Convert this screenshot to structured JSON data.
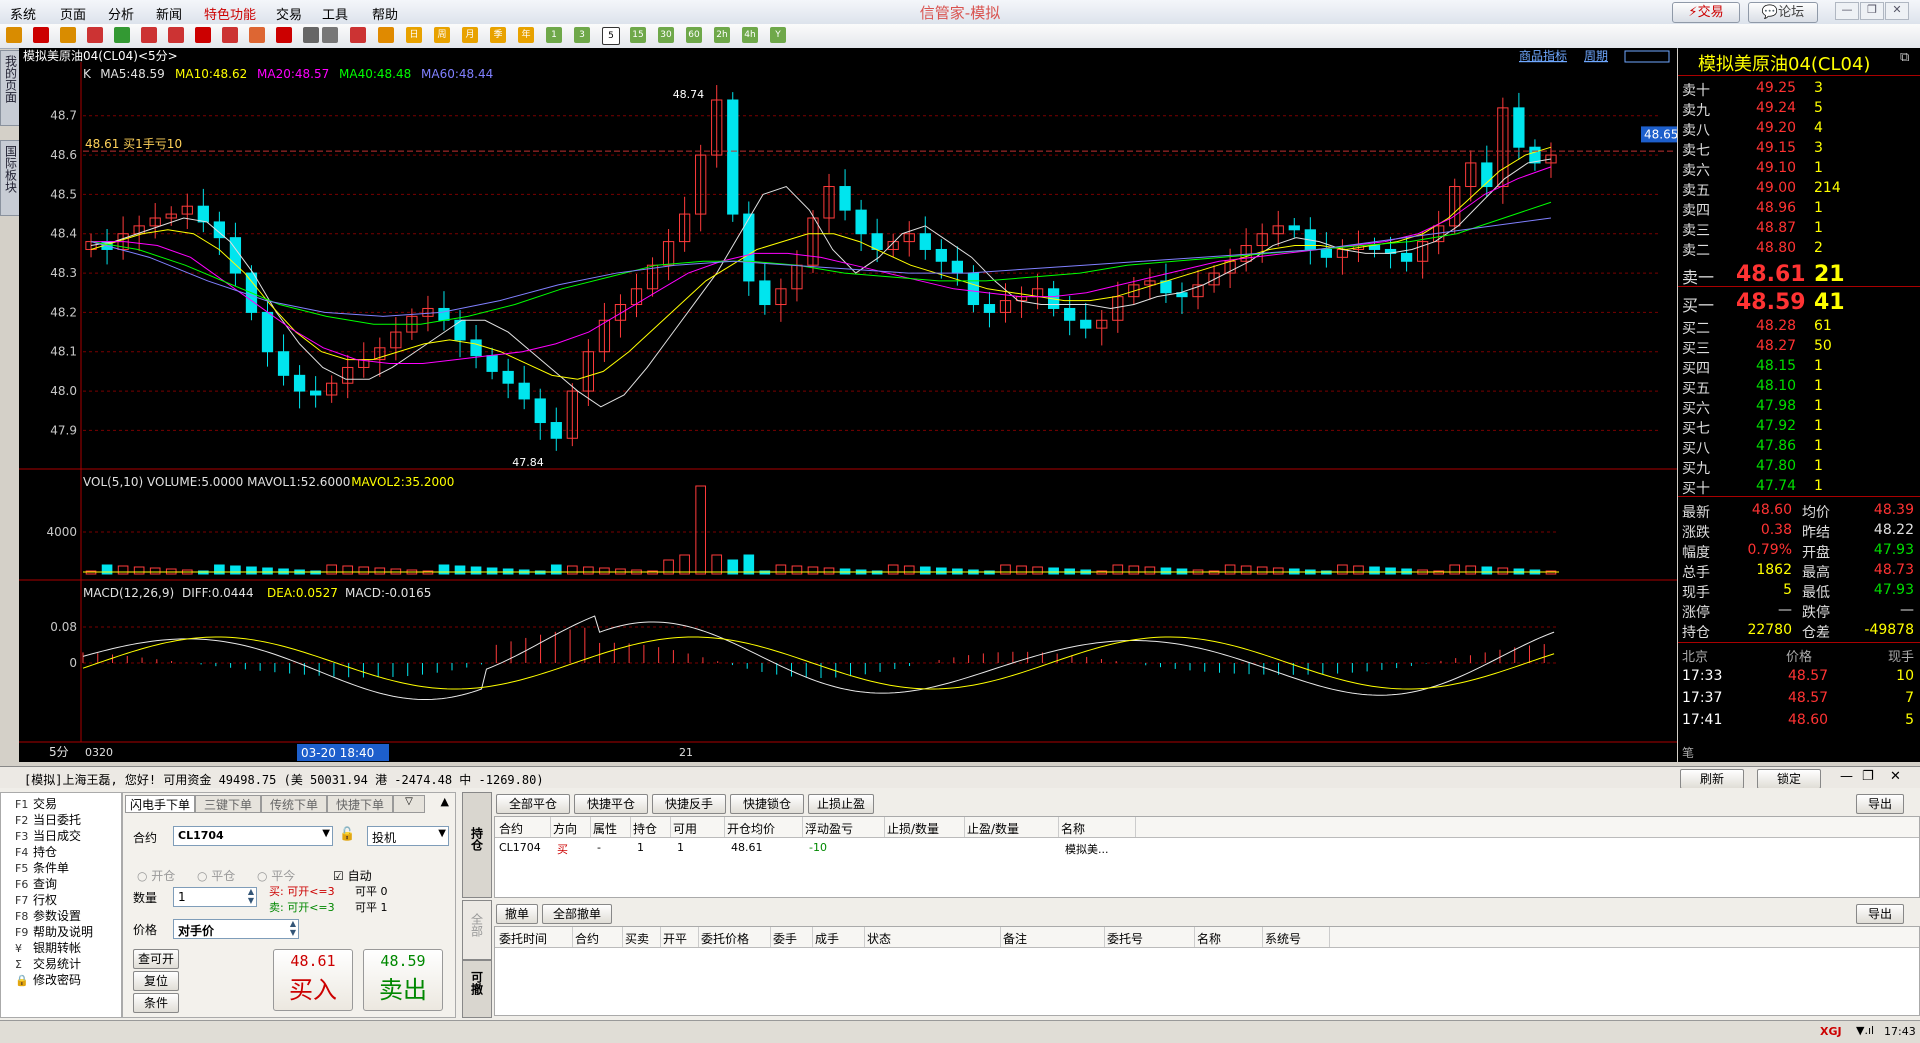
{
  "menu": [
    "系统",
    "页面",
    "分析",
    "新闻",
    "特色功能",
    "交易",
    "工具",
    "帮助"
  ],
  "app_title": "信管家-模拟",
  "top_buttons": {
    "trade": "交易",
    "forum": "论坛"
  },
  "toolbar_periods": [
    "日",
    "周",
    "月",
    "季",
    "年",
    "1",
    "3",
    "5",
    "15",
    "30",
    "60",
    "2h",
    "4h",
    "Y"
  ],
  "left_tabs": {
    "my_page": "我的页面",
    "intl_board": "国际板块"
  },
  "chart": {
    "instrument": "模拟美原油04(CL04)<5分>",
    "links": {
      "product": "商品指标",
      "period": "周期"
    },
    "ma_legend": [
      {
        "text": "K",
        "color": "#e0e0e0"
      },
      {
        "text": "MA5:48.59",
        "color": "#e0e0e0"
      },
      {
        "text": "MA10:48.62",
        "color": "#ffff00"
      },
      {
        "text": "MA20:48.57",
        "color": "#ff00ff"
      },
      {
        "text": "MA40:48.48",
        "color": "#00ff00"
      },
      {
        "text": "MA60:48.44",
        "color": "#8080ff"
      }
    ],
    "position_line_label": "48.61 买1手亏10",
    "price_ticks": [
      "48.7",
      "48.6",
      "48.5",
      "48.4",
      "48.3",
      "48.2",
      "48.1",
      "48.0",
      "47.9"
    ],
    "high_label": "48.74",
    "low_label": "47.84",
    "current_price_tag": "48.65",
    "vol_legend": [
      {
        "text": "VOL(5,10) VOLUME:5.0000 MAVOL1:52.6000",
        "color": "#e0e0e0"
      },
      {
        "text": "MAVOL2:35.2000",
        "color": "#ffff00"
      }
    ],
    "vol_tick": "4000",
    "macd_legend": [
      {
        "text": "MACD(12,26,9)",
        "color": "#e0e0e0"
      },
      {
        "text": "DIFF:0.0444",
        "color": "#e0e0e0"
      },
      {
        "text": "DEA:0.0527",
        "color": "#ffff00"
      },
      {
        "text": "MACD:-0.0165",
        "color": "#e0e0e0"
      }
    ],
    "macd_ticks": [
      "0.08",
      "0"
    ],
    "x_period": "5分",
    "x_labels": [
      "0320",
      "21"
    ],
    "cursor_time": "03-20 18:40"
  },
  "chart_data": {
    "type": "candlestick",
    "price_range": [
      47.84,
      48.74
    ],
    "close": [
      48.38,
      48.36,
      48.4,
      48.42,
      48.44,
      48.45,
      48.47,
      48.43,
      48.39,
      48.3,
      48.2,
      48.1,
      48.04,
      48.0,
      47.99,
      48.02,
      48.06,
      48.08,
      48.11,
      48.15,
      48.19,
      48.21,
      48.18,
      48.13,
      48.09,
      48.05,
      48.02,
      47.98,
      47.92,
      47.88,
      48.0,
      48.1,
      48.18,
      48.22,
      48.26,
      48.32,
      48.38,
      48.45,
      48.6,
      48.74,
      48.45,
      48.28,
      48.22,
      48.26,
      48.32,
      48.44,
      48.52,
      48.46,
      48.4,
      48.36,
      48.38,
      48.4,
      48.36,
      48.33,
      48.3,
      48.22,
      48.2,
      48.23,
      48.24,
      48.26,
      48.21,
      48.18,
      48.16,
      48.18,
      48.24,
      48.27,
      48.28,
      48.25,
      48.24,
      48.27,
      48.3,
      48.33,
      48.37,
      48.4,
      48.42,
      48.41,
      48.36,
      48.34,
      48.36,
      48.37,
      48.36,
      48.35,
      48.33,
      48.38,
      48.42,
      48.52,
      48.58,
      48.52,
      48.72,
      48.62,
      48.58,
      48.6
    ],
    "series": [
      {
        "name": "MA5",
        "values": [
          48.37,
          48.38,
          48.4,
          48.42,
          48.44,
          48.43,
          48.38,
          48.3,
          48.2,
          48.12,
          48.06,
          48.03,
          48.03,
          48.06,
          48.1,
          48.14,
          48.18,
          48.18,
          48.15,
          48.1,
          48.05,
          48.0,
          47.96,
          47.99,
          48.06,
          48.14,
          48.22,
          48.3,
          48.4,
          48.5,
          48.52,
          48.46,
          48.36,
          48.3,
          48.34,
          48.4,
          48.42,
          48.38,
          48.34,
          48.28,
          48.23,
          48.22,
          48.22,
          48.22,
          48.21,
          48.22,
          48.24,
          48.25,
          48.27,
          48.3,
          48.33,
          48.37,
          48.39,
          48.38,
          48.36,
          48.35,
          48.35,
          48.36,
          48.38,
          48.42,
          48.48,
          48.54,
          48.58,
          48.59
        ]
      },
      {
        "name": "MA10",
        "values": [
          48.36,
          48.38,
          48.4,
          48.41,
          48.4,
          48.36,
          48.3,
          48.22,
          48.15,
          48.1,
          48.08,
          48.08,
          48.1,
          48.12,
          48.13,
          48.12,
          48.1,
          48.07,
          48.04,
          48.03,
          48.05,
          48.1,
          48.16,
          48.22,
          48.28,
          48.32,
          48.36,
          48.38,
          48.4,
          48.4,
          48.38,
          48.35,
          48.32,
          48.3,
          48.28,
          48.26,
          48.25,
          48.24,
          48.23,
          48.23,
          48.24,
          48.26,
          48.28,
          48.3,
          48.32,
          48.34,
          48.36,
          48.37,
          48.37,
          48.36,
          48.37,
          48.38,
          48.4,
          48.44,
          48.5,
          48.56,
          48.6,
          48.62
        ]
      },
      {
        "name": "MA20",
        "values": [
          48.38,
          48.38,
          48.37,
          48.34,
          48.28,
          48.22,
          48.16,
          48.11,
          48.08,
          48.07,
          48.07,
          48.08,
          48.09,
          48.1,
          48.12,
          48.15,
          48.2,
          48.25,
          48.3,
          48.33,
          48.35,
          48.35,
          48.34,
          48.32,
          48.3,
          48.28,
          48.26,
          48.25,
          48.24,
          48.24,
          48.25,
          48.27,
          48.29,
          48.31,
          48.33,
          48.34,
          48.35,
          48.36,
          48.37,
          48.38,
          48.4,
          48.44,
          48.5,
          48.54,
          48.57
        ]
      },
      {
        "name": "MA40",
        "values": [
          48.38,
          48.36,
          48.32,
          48.27,
          48.22,
          48.19,
          48.17,
          48.17,
          48.19,
          48.22,
          48.26,
          48.29,
          48.32,
          48.33,
          48.33,
          48.32,
          48.3,
          48.29,
          48.28,
          48.28,
          48.29,
          48.3,
          48.32,
          48.33,
          48.34,
          48.35,
          48.36,
          48.37,
          48.38,
          48.4,
          48.44,
          48.48
        ]
      },
      {
        "name": "MA60",
        "values": [
          48.38,
          48.34,
          48.28,
          48.23,
          48.2,
          48.19,
          48.2,
          48.23,
          48.27,
          48.3,
          48.32,
          48.33,
          48.32,
          48.31,
          48.3,
          48.3,
          48.31,
          48.32,
          48.33,
          48.34,
          48.35,
          48.36,
          48.38,
          48.4,
          48.42,
          48.44
        ]
      }
    ],
    "volume_peak": 4000
  },
  "book": {
    "title": "模拟美原油04(CL04)",
    "asks": [
      {
        "label": "卖十",
        "price": "49.25",
        "qty": "3"
      },
      {
        "label": "卖九",
        "price": "49.24",
        "qty": "5"
      },
      {
        "label": "卖八",
        "price": "49.20",
        "qty": "4"
      },
      {
        "label": "卖七",
        "price": "49.15",
        "qty": "3"
      },
      {
        "label": "卖六",
        "price": "49.10",
        "qty": "1"
      },
      {
        "label": "卖五",
        "price": "49.00",
        "qty": "214"
      },
      {
        "label": "卖四",
        "price": "48.96",
        "qty": "1"
      },
      {
        "label": "卖三",
        "price": "48.87",
        "qty": "1"
      },
      {
        "label": "卖二",
        "price": "48.80",
        "qty": "2"
      },
      {
        "label": "卖一",
        "price": "48.61",
        "qty": "21"
      }
    ],
    "bids": [
      {
        "label": "买一",
        "price": "48.59",
        "qty": "41"
      },
      {
        "label": "买二",
        "price": "48.28",
        "qty": "61"
      },
      {
        "label": "买三",
        "price": "48.27",
        "qty": "50"
      },
      {
        "label": "买四",
        "price": "48.15",
        "qty": "1"
      },
      {
        "label": "买五",
        "price": "48.10",
        "qty": "1"
      },
      {
        "label": "买六",
        "price": "47.98",
        "qty": "1"
      },
      {
        "label": "买七",
        "price": "47.92",
        "qty": "1"
      },
      {
        "label": "买八",
        "price": "47.86",
        "qty": "1"
      },
      {
        "label": "买九",
        "price": "47.80",
        "qty": "1"
      },
      {
        "label": "买十",
        "price": "47.74",
        "qty": "1"
      }
    ],
    "stats": [
      {
        "l1": "最新",
        "v1": "48.60",
        "c1": "#ff3333",
        "l2": "均价",
        "v2": "48.39",
        "c2": "#ff3333"
      },
      {
        "l1": "涨跌",
        "v1": "0.38",
        "c1": "#ff3333",
        "l2": "昨结",
        "v2": "48.22",
        "c2": "#e0e0e0"
      },
      {
        "l1": "幅度",
        "v1": "0.79%",
        "c1": "#ff3333",
        "l2": "开盘",
        "v2": "47.93",
        "c2": "#00dd00"
      },
      {
        "l1": "总手",
        "v1": "1862",
        "c1": "#ffff00",
        "l2": "最高",
        "v2": "48.73",
        "c2": "#ff3333"
      },
      {
        "l1": "现手",
        "v1": "5",
        "c1": "#ffff00",
        "l2": "最低",
        "v2": "47.93",
        "c2": "#00dd00"
      },
      {
        "l1": "涨停",
        "v1": "—",
        "c1": "#e0e0e0",
        "l2": "跌停",
        "v2": "—",
        "c2": "#e0e0e0"
      },
      {
        "l1": "持仓",
        "v1": "22780",
        "c1": "#ffff00",
        "l2": "仓差",
        "v2": "-49878",
        "c2": "#ffff00"
      }
    ],
    "ticks_header": {
      "place": "北京",
      "price": "价格",
      "qty": "现手"
    },
    "ticks": [
      {
        "time": "17:33",
        "price": "48.57",
        "qty": "10"
      },
      {
        "time": "17:37",
        "price": "48.57",
        "qty": "7"
      },
      {
        "time": "17:41",
        "price": "48.60",
        "qty": "5"
      }
    ],
    "footer_label": "笔"
  },
  "account": {
    "text": "[模拟]上海王磊, 您好! 可用资金 49498.75 (美 50031.94 港 -2474.48 中 -1269.80)",
    "refresh": "刷新",
    "lock": "锁定"
  },
  "functions": [
    {
      "key": "F1",
      "label": "交易"
    },
    {
      "key": "F2",
      "label": "当日委托"
    },
    {
      "key": "F3",
      "label": "当日成交"
    },
    {
      "key": "F4",
      "label": "持仓"
    },
    {
      "key": "F5",
      "label": "条件单"
    },
    {
      "key": "F6",
      "label": "查询"
    },
    {
      "key": "F7",
      "label": "行权"
    },
    {
      "key": "F8",
      "label": "参数设置"
    },
    {
      "key": "F9",
      "label": "帮助及说明"
    },
    {
      "key": "¥",
      "label": "银期转帐"
    },
    {
      "key": "Σ",
      "label": "交易统计"
    },
    {
      "key": "🔒",
      "label": "修改密码"
    }
  ],
  "order": {
    "tabs": [
      "闪电手下单",
      "三键下单",
      "传统下单",
      "快捷下单"
    ],
    "contract_label": "合约",
    "contract": "CL1704",
    "speculate": "投机",
    "open": "开仓",
    "close": "平仓",
    "close_today": "平今",
    "auto": "自动",
    "qty_label": "数量",
    "qty": "1",
    "buy_hint": "买: 可开<=3",
    "sell_hint": "卖: 可开<=3",
    "buy_close": "可平 0",
    "sell_close": "可平 1",
    "price_label": "价格",
    "price_type": "对手价",
    "query_btn": "查可开",
    "reset_btn": "复位",
    "cond_btn": "条件",
    "buy_price": "48.61",
    "buy_label": "买入",
    "sell_price": "48.59",
    "sell_label": "卖出"
  },
  "side_tabs": {
    "position": "持仓",
    "all": "全部",
    "cancelable": "可撤"
  },
  "positions": {
    "buttons": [
      "全部平仓",
      "快捷平仓",
      "快捷反手",
      "快捷锁仓",
      "止损止盈"
    ],
    "export": "导出",
    "headers": [
      "合约",
      "方向",
      "属性",
      "持仓",
      "可用",
      "开仓均价",
      "浮动盈亏",
      "止损/数量",
      "止盈/数量",
      "名称"
    ],
    "rows": [
      [
        "CL1704",
        "买",
        "-",
        "1",
        "1",
        "48.61",
        "-10",
        "",
        "",
        "模拟美..."
      ]
    ]
  },
  "orders": {
    "buttons": [
      "撤单",
      "全部撤单"
    ],
    "export": "导出",
    "headers": [
      "委托时间",
      "合约",
      "买卖",
      "开平",
      "委托价格",
      "委手",
      "成手",
      "状态",
      "备注",
      "委托号",
      "名称",
      "系统号"
    ]
  },
  "status": {
    "time": "17:43",
    "brand": "XGJ"
  }
}
